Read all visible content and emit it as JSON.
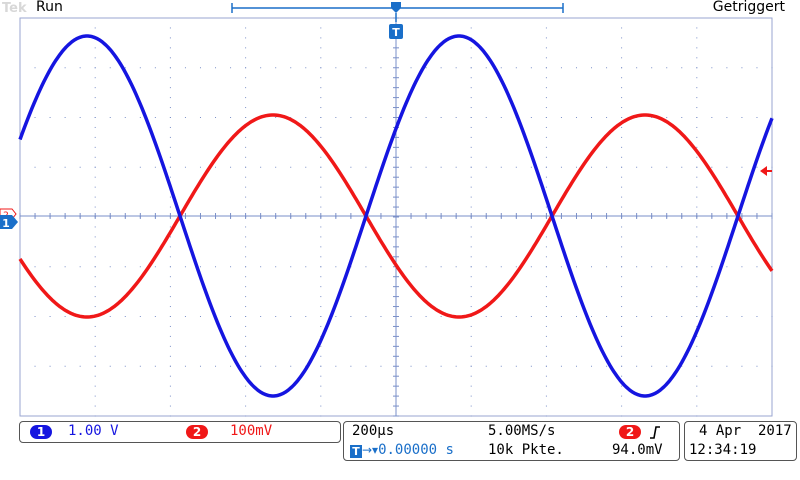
{
  "header": {
    "logo": "Tek",
    "run_state": "Run",
    "trigger_state": "Getriggert"
  },
  "colors": {
    "ch1": "#1515e0",
    "ch2": "#f01818",
    "graticule": "#7a8fc8",
    "marker_blue": "#1a6fc9"
  },
  "markers": {
    "trigger_position": "T",
    "ch1_ground": "1",
    "ch2_ground": "2"
  },
  "channels": [
    {
      "number": "1",
      "scale": "1.00 V"
    },
    {
      "number": "2",
      "scale": "100mV"
    }
  ],
  "timebase": {
    "time_per_div": "200µs",
    "sample_rate": "5.00MS/s",
    "delay": "0.00000 s",
    "record_length": "10k Pkte."
  },
  "trigger": {
    "source": "2",
    "slope_icon": "rising-edge-icon",
    "level": "94.0mV"
  },
  "datetime": {
    "date": "4 Apr  2017",
    "time": "12:34:19"
  }
}
